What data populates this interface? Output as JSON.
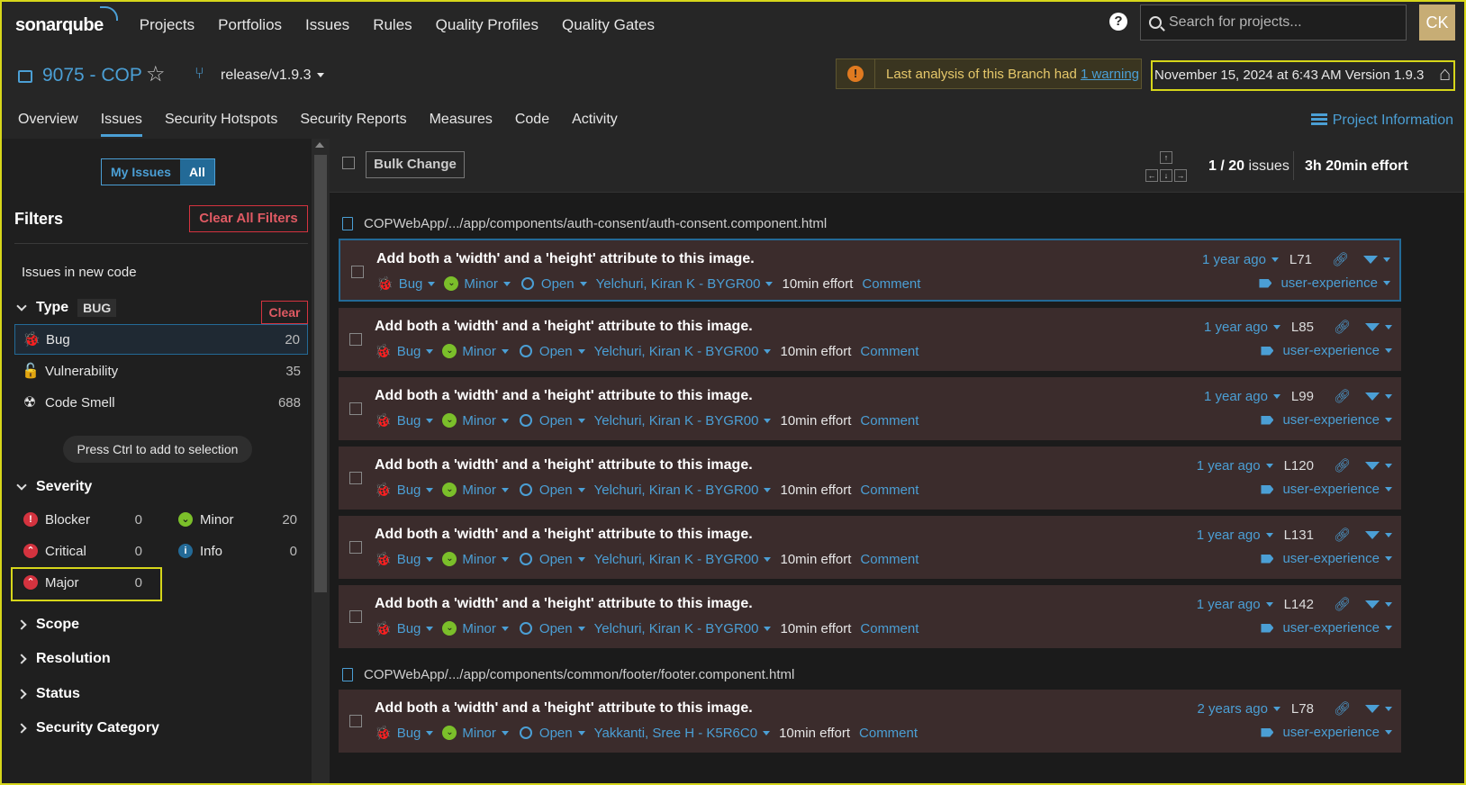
{
  "app": {
    "logo": "sonarqube",
    "nav": [
      "Projects",
      "Portfolios",
      "Issues",
      "Rules",
      "Quality Profiles",
      "Quality Gates"
    ],
    "search_placeholder": "Search for projects...",
    "avatar_initials": "CK",
    "help_icon": "?"
  },
  "project": {
    "name": "9075 - COP",
    "branch": "release/v1.9.3",
    "warning_text": "Last analysis of this Branch had ",
    "warning_link": "1 warning",
    "analysis_date": "November 15, 2024 at 6:43 AM  Version 1.9.3",
    "tabs": [
      "Overview",
      "Issues",
      "Security Hotspots",
      "Security Reports",
      "Measures",
      "Code",
      "Activity"
    ],
    "active_tab": "Issues",
    "project_info": "Project Information"
  },
  "sidebar": {
    "toggle": [
      "My Issues",
      "All"
    ],
    "filters_title": "Filters",
    "clear_all": "Clear All Filters",
    "new_code": "Issues in new code",
    "type_header": "Type",
    "type_badge": "BUG",
    "clear": "Clear",
    "types": [
      {
        "label": "Bug",
        "count": "20",
        "icon": "bug-icon"
      },
      {
        "label": "Vulnerability",
        "count": "35",
        "icon": "lock-icon"
      },
      {
        "label": "Code Smell",
        "count": "688",
        "icon": "code-smell-icon"
      }
    ],
    "hint": "Press Ctrl to add to selection",
    "severity_header": "Severity",
    "severities": [
      {
        "label": "Blocker",
        "count": "0",
        "color": "#d4333f"
      },
      {
        "label": "Minor",
        "count": "20",
        "color": "#7bbf2a"
      },
      {
        "label": "Critical",
        "count": "0",
        "color": "#d4333f"
      },
      {
        "label": "Info",
        "count": "0",
        "color": "#236a97"
      },
      {
        "label": "Major",
        "count": "0",
        "color": "#d4333f"
      }
    ],
    "collapsed_facets": [
      "Scope",
      "Resolution",
      "Status",
      "Security Category"
    ]
  },
  "toolbar": {
    "bulk_change": "Bulk Change",
    "count_current": "1 / 20",
    "count_label": " issues",
    "effort": "3h 20min effort"
  },
  "files": [
    {
      "path": "COPWebApp/.../app/components/auth-consent/auth-consent.component.html"
    },
    {
      "path": "COPWebApp/.../app/components/common/footer/footer.component.html"
    }
  ],
  "issues": [
    {
      "title": "Add both a 'width' and a 'height' attribute to this image.",
      "type": "Bug",
      "severity": "Minor",
      "status": "Open",
      "assignee": "Yelchuri, Kiran K - BYGR00",
      "effort": "10min effort",
      "comment": "Comment",
      "age": "1 year ago",
      "line": "L71",
      "tag": "user-experience"
    },
    {
      "title": "Add both a 'width' and a 'height' attribute to this image.",
      "type": "Bug",
      "severity": "Minor",
      "status": "Open",
      "assignee": "Yelchuri, Kiran K - BYGR00",
      "effort": "10min effort",
      "comment": "Comment",
      "age": "1 year ago",
      "line": "L85",
      "tag": "user-experience"
    },
    {
      "title": "Add both a 'width' and a 'height' attribute to this image.",
      "type": "Bug",
      "severity": "Minor",
      "status": "Open",
      "assignee": "Yelchuri, Kiran K - BYGR00",
      "effort": "10min effort",
      "comment": "Comment",
      "age": "1 year ago",
      "line": "L99",
      "tag": "user-experience"
    },
    {
      "title": "Add both a 'width' and a 'height' attribute to this image.",
      "type": "Bug",
      "severity": "Minor",
      "status": "Open",
      "assignee": "Yelchuri, Kiran K - BYGR00",
      "effort": "10min effort",
      "comment": "Comment",
      "age": "1 year ago",
      "line": "L120",
      "tag": "user-experience"
    },
    {
      "title": "Add both a 'width' and a 'height' attribute to this image.",
      "type": "Bug",
      "severity": "Minor",
      "status": "Open",
      "assignee": "Yelchuri, Kiran K - BYGR00",
      "effort": "10min effort",
      "comment": "Comment",
      "age": "1 year ago",
      "line": "L131",
      "tag": "user-experience"
    },
    {
      "title": "Add both a 'width' and a 'height' attribute to this image.",
      "type": "Bug",
      "severity": "Minor",
      "status": "Open",
      "assignee": "Yelchuri, Kiran K - BYGR00",
      "effort": "10min effort",
      "comment": "Comment",
      "age": "1 year ago",
      "line": "L142",
      "tag": "user-experience"
    },
    {
      "title": "Add both a 'width' and a 'height' attribute to this image.",
      "type": "Bug",
      "severity": "Minor",
      "status": "Open",
      "assignee": "Yakkanti, Sree H - K5R6C0",
      "effort": "10min effort",
      "comment": "Comment",
      "age": "2 years ago",
      "line": "L78",
      "tag": "user-experience"
    }
  ],
  "colors": {
    "accent": "#4b9fd5",
    "issue_bg": "#3b2c2c",
    "highlight": "#d6d61a",
    "danger": "#d4333f",
    "minor": "#7bbf2a"
  }
}
